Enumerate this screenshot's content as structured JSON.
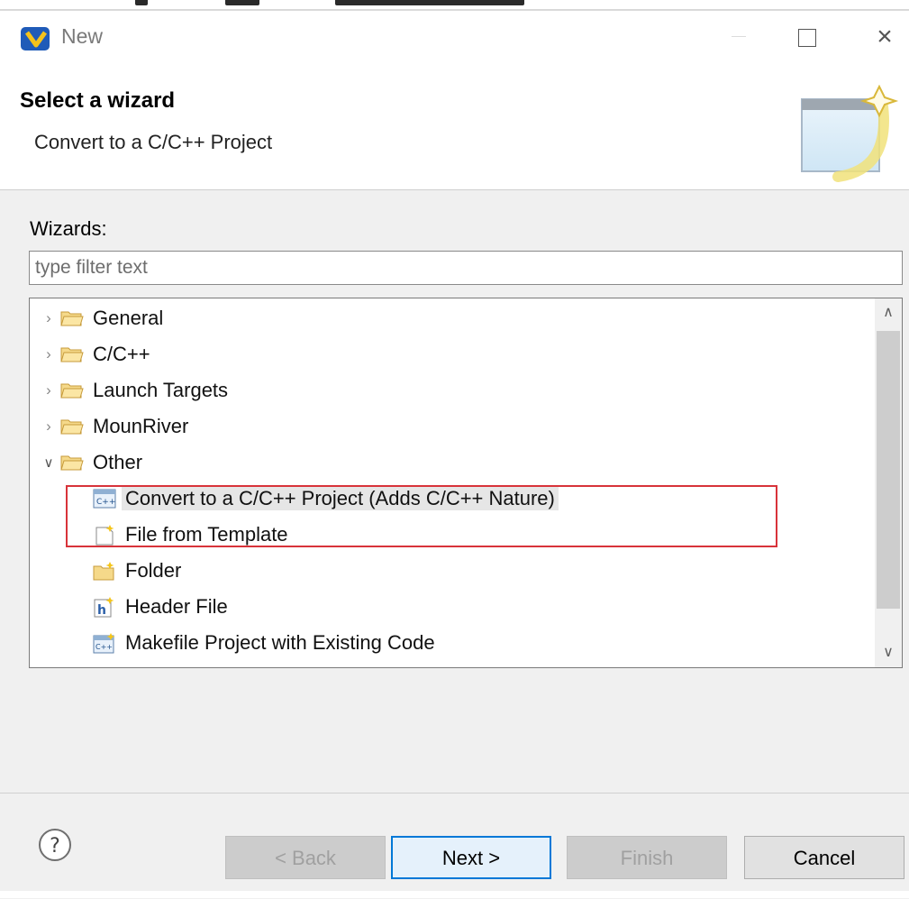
{
  "window": {
    "title": "New"
  },
  "header": {
    "title": "Select a wizard",
    "description": "Convert to a C/C++ Project"
  },
  "wizards": {
    "label": "Wizards:",
    "filter_placeholder": "type filter text",
    "tree": [
      {
        "label": "General",
        "expanded": false,
        "icon": "folder-icon"
      },
      {
        "label": "C/C++",
        "expanded": false,
        "icon": "folder-icon"
      },
      {
        "label": "Launch Targets",
        "expanded": false,
        "icon": "folder-icon"
      },
      {
        "label": "MounRiver",
        "expanded": false,
        "icon": "folder-icon"
      },
      {
        "label": "Other",
        "expanded": true,
        "icon": "folder-icon",
        "children": [
          {
            "label": "Convert to a C/C++ Project (Adds C/C++ Nature)",
            "icon": "cpp-convert-icon",
            "selected": true
          },
          {
            "label": "File from Template",
            "icon": "file-template-icon"
          },
          {
            "label": "Folder",
            "icon": "new-folder-icon"
          },
          {
            "label": "Header File",
            "icon": "header-file-icon"
          },
          {
            "label": "Makefile Project with Existing Code",
            "icon": "makefile-project-icon"
          }
        ]
      }
    ]
  },
  "buttons": {
    "back": "< Back",
    "next": "Next >",
    "finish": "Finish",
    "cancel": "Cancel"
  },
  "colors": {
    "highlight_border": "#d8333a",
    "default_button_border": "#0078d7",
    "folder_fill": "#f5d98a",
    "folder_stroke": "#c79b3b"
  }
}
